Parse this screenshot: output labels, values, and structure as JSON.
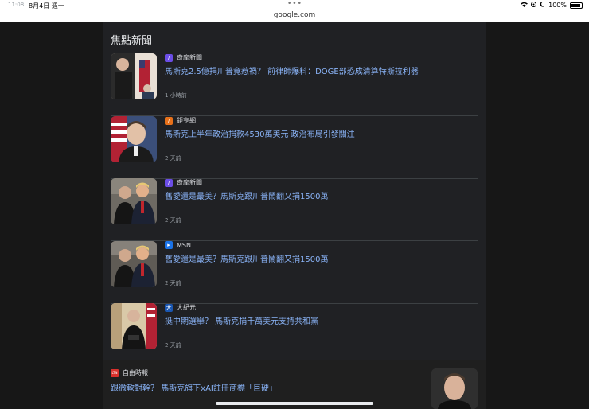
{
  "status_bar": {
    "time": "11:08",
    "date": "8月4日 週一",
    "dots": "•••",
    "battery": "100%"
  },
  "url_bar": {
    "url": "google.com"
  },
  "section": {
    "title": "焦點新聞"
  },
  "items": [
    {
      "source": "奇摩新聞",
      "headline": "馬斯克2.5億捐川普竟惹禍？ 前律師爆料：DOGE部恐成清算特斯拉利器",
      "time": "1 小時前",
      "icon_color": "#6b4de6",
      "thumb_desc": "musk-flag-photo"
    },
    {
      "source": "鉅亨網",
      "headline": "馬斯克上半年政治捐款4530萬美元 政治布局引發關注",
      "time": "2 天前",
      "icon_color": "#e8711a",
      "thumb_desc": "musk-portrait-photo"
    },
    {
      "source": "奇摩新聞",
      "headline": "舊愛還是最美？馬斯克跟川普鬧翻又捐1500萬",
      "time": "2 天前",
      "icon_color": "#6b4de6",
      "thumb_desc": "musk-trump-photo"
    },
    {
      "source": "MSN",
      "headline": "舊愛還是最美？馬斯克跟川普鬧翻又捐1500萬",
      "time": "2 天前",
      "icon_color": "#1a73e8",
      "thumb_desc": "musk-trump-photo-2"
    },
    {
      "source": "大紀元",
      "headline": "挺中期選舉？ 馬斯克捐千萬美元支持共和黨",
      "time": "2 天前",
      "icon_color": "#1a56b0",
      "thumb_desc": "musk-podium-photo"
    }
  ],
  "bottom": {
    "source": "自由時報",
    "source_logo": "LTN",
    "headline": "跟微軟對幹？ 馬斯克旗下xAI註冊商標「巨硬」"
  }
}
